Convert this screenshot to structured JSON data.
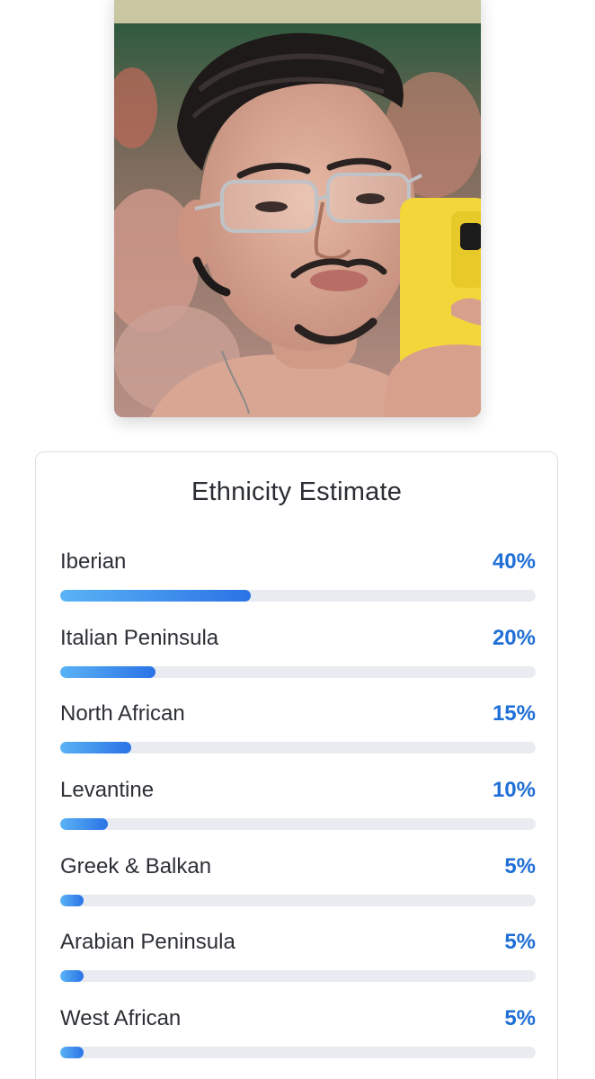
{
  "photo": {
    "description_icon": "portrait-photo"
  },
  "panel": {
    "title": "Ethnicity Estimate",
    "accent_color": "#1f6fd6",
    "items": [
      {
        "label": "Iberian",
        "percent_label": "40%",
        "value": 40
      },
      {
        "label": "Italian Peninsula",
        "percent_label": "20%",
        "value": 20
      },
      {
        "label": "North African",
        "percent_label": "15%",
        "value": 15
      },
      {
        "label": "Levantine",
        "percent_label": "10%",
        "value": 10
      },
      {
        "label": "Greek & Balkan",
        "percent_label": "5%",
        "value": 5
      },
      {
        "label": "Arabian Peninsula",
        "percent_label": "5%",
        "value": 5
      },
      {
        "label": "West African",
        "percent_label": "5%",
        "value": 5
      }
    ]
  }
}
